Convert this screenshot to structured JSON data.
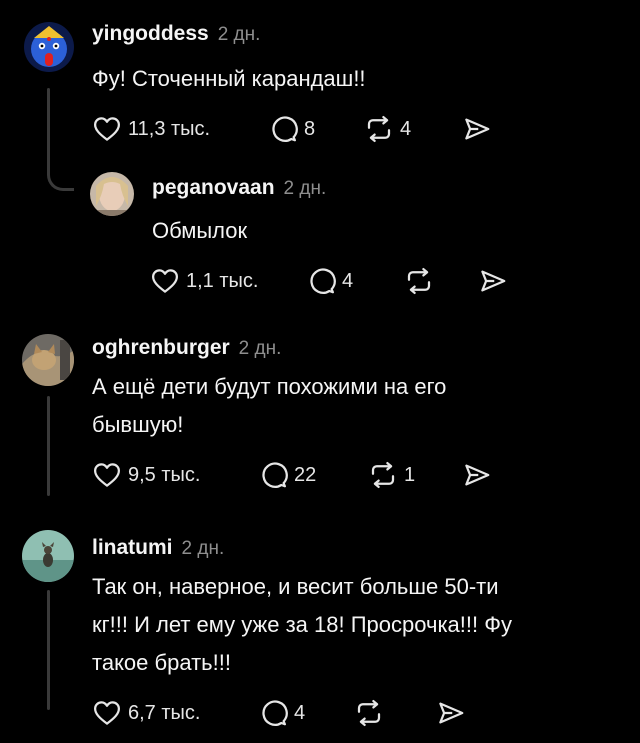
{
  "comments": [
    {
      "username": "yingoddess",
      "time": "2 дн.",
      "text": "Фу! Сточенный карандаш!!",
      "likes": "11,3 тыс.",
      "replies": "8",
      "reposts": "4",
      "avatar_icon": "goddess-face-avatar",
      "avatar_colors": [
        "#2c60d8",
        "#0c1a4a"
      ],
      "reply": {
        "username": "peganovaan",
        "time": "2 дн.",
        "text": "Обмылок",
        "likes": "1,1 тыс.",
        "replies": "4",
        "reposts": "",
        "avatar_icon": "portrait-photo-avatar"
      }
    },
    {
      "username": "oghrenburger",
      "time": "2 дн.",
      "text_lines": [
        "А ещё дети будут похожими на его",
        "бывшую!"
      ],
      "likes": "9,5 тыс.",
      "replies": "22",
      "reposts": "1",
      "avatar_icon": "cat-photo-avatar"
    },
    {
      "username": "linatumi",
      "time": "2 дн.",
      "text_lines": [
        "Так он, наверное, и весит больше 50-ти",
        "кг!!! И лет ему уже за 18! Просрочка!!! Фу",
        "такое брать!!!"
      ],
      "likes": "6,7 тыс.",
      "replies": "4",
      "reposts": "",
      "avatar_icon": "water-photo-avatar"
    }
  ]
}
